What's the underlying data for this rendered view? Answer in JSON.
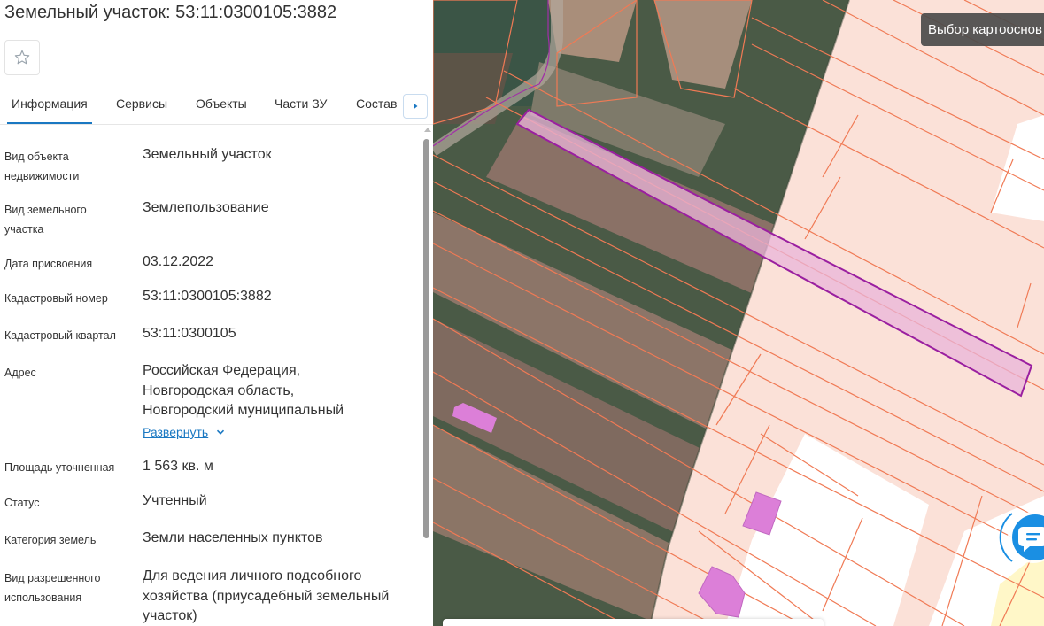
{
  "panel": {
    "title": "Земельный участок: 53:11:0300105:3882",
    "favorite_icon": "star-outline-icon",
    "tabs": [
      {
        "label": "Информация",
        "active": true
      },
      {
        "label": "Сервисы"
      },
      {
        "label": "Объекты"
      },
      {
        "label": "Части ЗУ"
      },
      {
        "label": "Состав"
      }
    ],
    "tabs_next_icon": "caret-right-icon",
    "properties": [
      {
        "label": "Вид объекта недвижимости",
        "value": "Земельный участок"
      },
      {
        "label": "Вид земельного участка",
        "value": "Землепользование"
      },
      {
        "label": "Дата присвоения",
        "value": "03.12.2022"
      },
      {
        "label": "Кадастровый номер",
        "value": "53:11:0300105:3882"
      },
      {
        "label": "Кадастровый квартал",
        "value": "53:11:0300105"
      },
      {
        "label": "Адрес",
        "value": "Российская Федерация, Новгородская область, Новгородский муниципальный"
      },
      {
        "label": "Площадь уточненная",
        "value": "1 563 кв. м"
      },
      {
        "label": "Статус",
        "value": "Учтенный"
      },
      {
        "label": "Категория земель",
        "value": "Земли населенных пунктов"
      },
      {
        "label": "Вид разрешенного использования",
        "value": "Для ведения личного подсобного хозяйства (приусадебный земельный участок)"
      }
    ],
    "expand_link": "Развернуть",
    "expand_icon": "chevron-down-icon"
  },
  "map": {
    "basemap_button": "Выбор картооснов",
    "chat_icon": "chat-bubble-icon",
    "colors": {
      "parcel_fill": "#fbe1d8",
      "parcel_border": "#f07a55",
      "selected_border": "#9a1fa0",
      "selected_fill": "#e9b4d9",
      "building_fill": "#dc7fd8",
      "chat_accent": "#1a8fe3"
    }
  }
}
